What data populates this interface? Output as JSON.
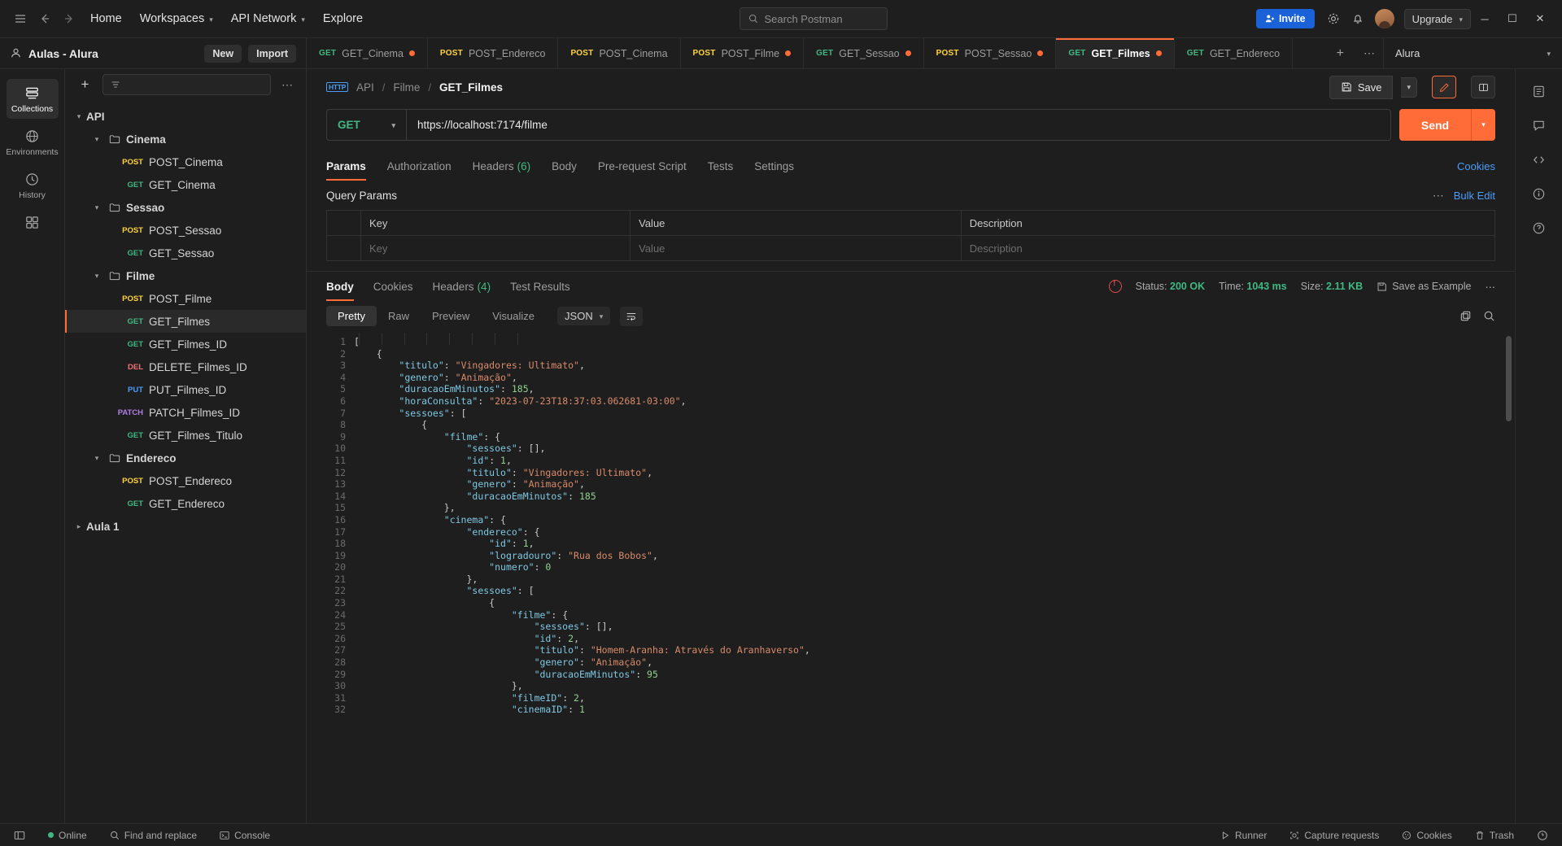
{
  "topbar": {
    "hamburger_icon": "hamburger-icon",
    "back_icon": "arrow-left-icon",
    "forward_icon": "arrow-right-icon",
    "home": "Home",
    "workspaces": "Workspaces",
    "api_network": "API Network",
    "explore": "Explore",
    "search_placeholder": "Search Postman",
    "invite": "Invite",
    "settings_icon": "gear-icon",
    "notifications_icon": "bell-icon",
    "upgrade": "Upgrade",
    "minimize": "─",
    "maximize": "☐",
    "close": "✕"
  },
  "workspace": {
    "name": "Aulas - Alura",
    "new_label": "New",
    "import_label": "Import",
    "environment": "Alura"
  },
  "request_tabs": [
    {
      "method": "GET",
      "label": "GET_Cinema",
      "dirty": true,
      "active": false
    },
    {
      "method": "POST",
      "label": "POST_Endereco",
      "dirty": false,
      "active": false
    },
    {
      "method": "POST",
      "label": "POST_Cinema",
      "dirty": false,
      "active": false
    },
    {
      "method": "POST",
      "label": "POST_Filme",
      "dirty": true,
      "active": false
    },
    {
      "method": "GET",
      "label": "GET_Sessao",
      "dirty": true,
      "active": false
    },
    {
      "method": "POST",
      "label": "POST_Sessao",
      "dirty": true,
      "active": false
    },
    {
      "method": "GET",
      "label": "GET_Filmes",
      "dirty": true,
      "active": true
    },
    {
      "method": "GET",
      "label": "GET_Endereco",
      "dirty": false,
      "active": false
    }
  ],
  "rail": [
    {
      "icon": "collections-icon",
      "label": "Collections",
      "active": true
    },
    {
      "icon": "environments-icon",
      "label": "Environments",
      "active": false
    },
    {
      "icon": "history-icon",
      "label": "History",
      "active": false
    },
    {
      "icon": "apps-icon",
      "label": "",
      "active": false
    }
  ],
  "sidebar": {
    "new_icon": "plus-icon",
    "filter_icon": "filter-icon",
    "more_icon": "ellipsis-icon",
    "tree": [
      {
        "depth": 0,
        "type": "collection",
        "label": "API",
        "expanded": true,
        "method": ""
      },
      {
        "depth": 1,
        "type": "folder",
        "label": "Cinema",
        "expanded": true,
        "method": ""
      },
      {
        "depth": 2,
        "type": "request",
        "label": "POST_Cinema",
        "method": "POST"
      },
      {
        "depth": 2,
        "type": "request",
        "label": "GET_Cinema",
        "method": "GET"
      },
      {
        "depth": 1,
        "type": "folder",
        "label": "Sessao",
        "expanded": true,
        "method": ""
      },
      {
        "depth": 2,
        "type": "request",
        "label": "POST_Sessao",
        "method": "POST"
      },
      {
        "depth": 2,
        "type": "request",
        "label": "GET_Sessao",
        "method": "GET"
      },
      {
        "depth": 1,
        "type": "folder",
        "label": "Filme",
        "expanded": true,
        "method": ""
      },
      {
        "depth": 2,
        "type": "request",
        "label": "POST_Filme",
        "method": "POST"
      },
      {
        "depth": 2,
        "type": "request",
        "label": "GET_Filmes",
        "method": "GET",
        "selected": true
      },
      {
        "depth": 2,
        "type": "request",
        "label": "GET_Filmes_ID",
        "method": "GET"
      },
      {
        "depth": 2,
        "type": "request",
        "label": "DELETE_Filmes_ID",
        "method": "DEL"
      },
      {
        "depth": 2,
        "type": "request",
        "label": "PUT_Filmes_ID",
        "method": "PUT"
      },
      {
        "depth": 2,
        "type": "request",
        "label": "PATCH_Filmes_ID",
        "method": "PATCH"
      },
      {
        "depth": 2,
        "type": "request",
        "label": "GET_Filmes_Titulo",
        "method": "GET"
      },
      {
        "depth": 1,
        "type": "folder",
        "label": "Endereco",
        "expanded": true,
        "method": ""
      },
      {
        "depth": 2,
        "type": "request",
        "label": "POST_Endereco",
        "method": "POST"
      },
      {
        "depth": 2,
        "type": "request",
        "label": "GET_Endereco",
        "method": "GET"
      },
      {
        "depth": 0,
        "type": "collection",
        "label": "Aula 1",
        "expanded": false,
        "method": ""
      }
    ]
  },
  "breadcrumb": {
    "protocol_icon": "http-icon",
    "items": [
      "API",
      "Filme",
      "GET_Filmes"
    ]
  },
  "actions": {
    "save_label": "Save",
    "save_icon": "floppy-icon",
    "caret": "⌄",
    "edit_icon": "pencil-icon",
    "panel_icon": "layout-icon"
  },
  "url_bar": {
    "method": "GET",
    "url": "https://localhost:7174/filme",
    "send_label": "Send",
    "caret": "⌄"
  },
  "request_subtabs": [
    {
      "label": "Params",
      "active": true,
      "count": ""
    },
    {
      "label": "Authorization",
      "active": false,
      "count": ""
    },
    {
      "label": "Headers",
      "active": false,
      "count": "(6)"
    },
    {
      "label": "Body",
      "active": false,
      "count": ""
    },
    {
      "label": "Pre-request Script",
      "active": false,
      "count": ""
    },
    {
      "label": "Tests",
      "active": false,
      "count": ""
    },
    {
      "label": "Settings",
      "active": false,
      "count": ""
    }
  ],
  "cookies_link": "Cookies",
  "query_params": {
    "title": "Query Params",
    "more_icon": "ellipsis-icon",
    "bulk_edit": "Bulk Edit",
    "headers": [
      "Key",
      "Value",
      "Description"
    ],
    "rows": [
      {
        "key": "Key",
        "value": "Value",
        "description": "Description"
      }
    ]
  },
  "response_tabs": [
    {
      "label": "Body",
      "active": true,
      "count": ""
    },
    {
      "label": "Cookies",
      "active": false,
      "count": ""
    },
    {
      "label": "Headers",
      "active": false,
      "count": "(4)"
    },
    {
      "label": "Test Results",
      "active": false,
      "count": ""
    }
  ],
  "response_meta": {
    "warning_icon": "globe-error-icon",
    "status_label": "Status:",
    "status_value": "200 OK",
    "time_label": "Time:",
    "time_value": "1043 ms",
    "size_label": "Size:",
    "size_value": "2.11 KB",
    "save_example": "Save as Example",
    "more_icon": "ellipsis-icon"
  },
  "response_view": {
    "modes": [
      {
        "label": "Pretty",
        "active": true
      },
      {
        "label": "Raw",
        "active": false
      },
      {
        "label": "Preview",
        "active": false
      },
      {
        "label": "Visualize",
        "active": false
      }
    ],
    "format": "JSON",
    "wrap_icon": "word-wrap-icon",
    "copy_icon": "copy-icon",
    "search_icon": "search-icon"
  },
  "response_body": {
    "lines": [
      {
        "n": 1,
        "indent": 0,
        "tokens": [
          {
            "t": "p",
            "v": "["
          }
        ]
      },
      {
        "n": 2,
        "indent": 1,
        "tokens": [
          {
            "t": "p",
            "v": "{"
          }
        ]
      },
      {
        "n": 3,
        "indent": 2,
        "tokens": [
          {
            "t": "k",
            "v": "\"titulo\""
          },
          {
            "t": "p",
            "v": ": "
          },
          {
            "t": "s",
            "v": "\"Vingadores: Ultimato\""
          },
          {
            "t": "p",
            "v": ","
          }
        ]
      },
      {
        "n": 4,
        "indent": 2,
        "tokens": [
          {
            "t": "k",
            "v": "\"genero\""
          },
          {
            "t": "p",
            "v": ": "
          },
          {
            "t": "s",
            "v": "\"Animação\""
          },
          {
            "t": "p",
            "v": ","
          }
        ]
      },
      {
        "n": 5,
        "indent": 2,
        "tokens": [
          {
            "t": "k",
            "v": "\"duracaoEmMinutos\""
          },
          {
            "t": "p",
            "v": ": "
          },
          {
            "t": "n",
            "v": "185"
          },
          {
            "t": "p",
            "v": ","
          }
        ]
      },
      {
        "n": 6,
        "indent": 2,
        "tokens": [
          {
            "t": "k",
            "v": "\"horaConsulta\""
          },
          {
            "t": "p",
            "v": ": "
          },
          {
            "t": "s",
            "v": "\"2023-07-23T18:37:03.062681-03:00\""
          },
          {
            "t": "p",
            "v": ","
          }
        ]
      },
      {
        "n": 7,
        "indent": 2,
        "tokens": [
          {
            "t": "k",
            "v": "\"sessoes\""
          },
          {
            "t": "p",
            "v": ": ["
          }
        ]
      },
      {
        "n": 8,
        "indent": 3,
        "tokens": [
          {
            "t": "p",
            "v": "{"
          }
        ]
      },
      {
        "n": 9,
        "indent": 4,
        "tokens": [
          {
            "t": "k",
            "v": "\"filme\""
          },
          {
            "t": "p",
            "v": ": {"
          }
        ]
      },
      {
        "n": 10,
        "indent": 5,
        "tokens": [
          {
            "t": "k",
            "v": "\"sessoes\""
          },
          {
            "t": "p",
            "v": ": [],"
          }
        ]
      },
      {
        "n": 11,
        "indent": 5,
        "tokens": [
          {
            "t": "k",
            "v": "\"id\""
          },
          {
            "t": "p",
            "v": ": "
          },
          {
            "t": "n",
            "v": "1"
          },
          {
            "t": "p",
            "v": ","
          }
        ]
      },
      {
        "n": 12,
        "indent": 5,
        "tokens": [
          {
            "t": "k",
            "v": "\"titulo\""
          },
          {
            "t": "p",
            "v": ": "
          },
          {
            "t": "s",
            "v": "\"Vingadores: Ultimato\""
          },
          {
            "t": "p",
            "v": ","
          }
        ]
      },
      {
        "n": 13,
        "indent": 5,
        "tokens": [
          {
            "t": "k",
            "v": "\"genero\""
          },
          {
            "t": "p",
            "v": ": "
          },
          {
            "t": "s",
            "v": "\"Animação\""
          },
          {
            "t": "p",
            "v": ","
          }
        ]
      },
      {
        "n": 14,
        "indent": 5,
        "tokens": [
          {
            "t": "k",
            "v": "\"duracaoEmMinutos\""
          },
          {
            "t": "p",
            "v": ": "
          },
          {
            "t": "n",
            "v": "185"
          }
        ]
      },
      {
        "n": 15,
        "indent": 4,
        "tokens": [
          {
            "t": "p",
            "v": "},"
          }
        ]
      },
      {
        "n": 16,
        "indent": 4,
        "tokens": [
          {
            "t": "k",
            "v": "\"cinema\""
          },
          {
            "t": "p",
            "v": ": {"
          }
        ]
      },
      {
        "n": 17,
        "indent": 5,
        "tokens": [
          {
            "t": "k",
            "v": "\"endereco\""
          },
          {
            "t": "p",
            "v": ": {"
          }
        ]
      },
      {
        "n": 18,
        "indent": 6,
        "tokens": [
          {
            "t": "k",
            "v": "\"id\""
          },
          {
            "t": "p",
            "v": ": "
          },
          {
            "t": "n",
            "v": "1"
          },
          {
            "t": "p",
            "v": ","
          }
        ]
      },
      {
        "n": 19,
        "indent": 6,
        "tokens": [
          {
            "t": "k",
            "v": "\"logradouro\""
          },
          {
            "t": "p",
            "v": ": "
          },
          {
            "t": "s",
            "v": "\"Rua dos Bobos\""
          },
          {
            "t": "p",
            "v": ","
          }
        ]
      },
      {
        "n": 20,
        "indent": 6,
        "tokens": [
          {
            "t": "k",
            "v": "\"numero\""
          },
          {
            "t": "p",
            "v": ": "
          },
          {
            "t": "n",
            "v": "0"
          }
        ]
      },
      {
        "n": 21,
        "indent": 5,
        "tokens": [
          {
            "t": "p",
            "v": "},"
          }
        ]
      },
      {
        "n": 22,
        "indent": 5,
        "tokens": [
          {
            "t": "k",
            "v": "\"sessoes\""
          },
          {
            "t": "p",
            "v": ": ["
          }
        ]
      },
      {
        "n": 23,
        "indent": 6,
        "tokens": [
          {
            "t": "p",
            "v": "{"
          }
        ]
      },
      {
        "n": 24,
        "indent": 7,
        "tokens": [
          {
            "t": "k",
            "v": "\"filme\""
          },
          {
            "t": "p",
            "v": ": {"
          }
        ]
      },
      {
        "n": 25,
        "indent": 8,
        "tokens": [
          {
            "t": "k",
            "v": "\"sessoes\""
          },
          {
            "t": "p",
            "v": ": [],"
          }
        ]
      },
      {
        "n": 26,
        "indent": 8,
        "tokens": [
          {
            "t": "k",
            "v": "\"id\""
          },
          {
            "t": "p",
            "v": ": "
          },
          {
            "t": "n",
            "v": "2"
          },
          {
            "t": "p",
            "v": ","
          }
        ]
      },
      {
        "n": 27,
        "indent": 8,
        "tokens": [
          {
            "t": "k",
            "v": "\"titulo\""
          },
          {
            "t": "p",
            "v": ": "
          },
          {
            "t": "s",
            "v": "\"Homem-Aranha: Através do Aranhaverso\""
          },
          {
            "t": "p",
            "v": ","
          }
        ]
      },
      {
        "n": 28,
        "indent": 8,
        "tokens": [
          {
            "t": "k",
            "v": "\"genero\""
          },
          {
            "t": "p",
            "v": ": "
          },
          {
            "t": "s",
            "v": "\"Animação\""
          },
          {
            "t": "p",
            "v": ","
          }
        ]
      },
      {
        "n": 29,
        "indent": 8,
        "tokens": [
          {
            "t": "k",
            "v": "\"duracaoEmMinutos\""
          },
          {
            "t": "p",
            "v": ": "
          },
          {
            "t": "n",
            "v": "95"
          }
        ]
      },
      {
        "n": 30,
        "indent": 7,
        "tokens": [
          {
            "t": "p",
            "v": "},"
          }
        ]
      },
      {
        "n": 31,
        "indent": 7,
        "tokens": [
          {
            "t": "k",
            "v": "\"filmeID\""
          },
          {
            "t": "p",
            "v": ": "
          },
          {
            "t": "n",
            "v": "2"
          },
          {
            "t": "p",
            "v": ","
          }
        ]
      },
      {
        "n": 32,
        "indent": 7,
        "tokens": [
          {
            "t": "k",
            "v": "\"cinemaID\""
          },
          {
            "t": "p",
            "v": ": "
          },
          {
            "t": "n",
            "v": "1"
          }
        ]
      }
    ]
  },
  "statusbar": {
    "sidebar_toggle_icon": "panel-toggle-icon",
    "online": "Online",
    "find_replace": "Find and replace",
    "console": "Console",
    "runner": "Runner",
    "capture": "Capture requests",
    "cookies": "Cookies",
    "trash": "Trash",
    "help_icon": "question-icon"
  },
  "right_rail": [
    "notes-icon",
    "comments-icon",
    "code-icon",
    "info-circle-icon",
    "documentation-icon"
  ],
  "colors": {
    "accent": "#ff6c37",
    "get": "#41b883",
    "post": "#ffd43b",
    "del": "#f07178",
    "put": "#4a9df8",
    "patch": "#b07fe3",
    "invite_blue": "#1b62d8"
  }
}
